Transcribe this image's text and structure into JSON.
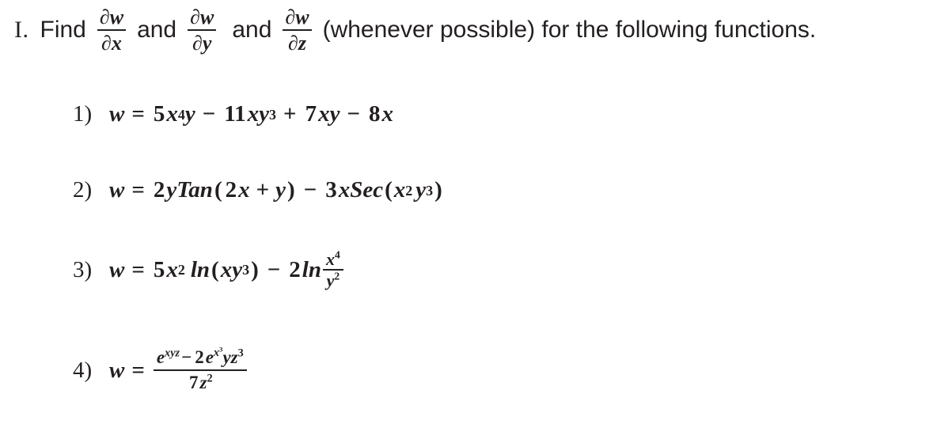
{
  "document": {
    "background_color": "#ffffff",
    "text_color": "#231f20"
  },
  "prompt": {
    "numeral": "I.",
    "verb": "Find",
    "derivative_1": {
      "numerator": "∂w",
      "denominator": "∂x"
    },
    "conjunction_1": "and",
    "derivative_2": {
      "numerator": "∂w",
      "denominator": "∂y"
    },
    "conjunction_2": "and",
    "derivative_3": {
      "numerator": "∂w",
      "denominator": "∂z"
    },
    "tail": "(whenever possible) for the following functions."
  },
  "problems": [
    {
      "number": "1)",
      "lhs": "w",
      "relation": "=",
      "plain": "w = 5x⁴y − 11xy³ + 7xy − 8x",
      "terms": {
        "t1_coef": "5",
        "t1_var": "x",
        "t1_exp": "4",
        "t1_var2": "y",
        "op1": "−",
        "t2_coef": "11",
        "t2_var": "xy",
        "t2_exp": "3",
        "op2": "+",
        "t3_coef": "7",
        "t3_var": "xy",
        "op3": "−",
        "t4_coef": "8",
        "t4_var": "x"
      }
    },
    {
      "number": "2)",
      "lhs": "w",
      "relation": "=",
      "plain": "w = 2yTan(2x + y) − 3xSec(x²y³)",
      "terms": {
        "t1_coef": "2",
        "t1_var": "y",
        "t1_fn": "Tan",
        "t1_arg_open": "(",
        "t1_arg_a": "2",
        "t1_arg_avar": "x",
        "t1_arg_op": "+",
        "t1_arg_b": "y",
        "t1_arg_close": ")",
        "op1": "−",
        "t2_coef": "3",
        "t2_var": "x",
        "t2_fn": "Sec",
        "t2_arg_open": "(",
        "t2_arg_a": "x",
        "t2_arg_aexp": "2",
        "t2_arg_b": "y",
        "t2_arg_bexp": "3",
        "t2_arg_close": ")"
      }
    },
    {
      "number": "3)",
      "lhs": "w",
      "relation": "=",
      "plain": "w = 5x² ln(xy³) − 2ln(x⁴/y²)",
      "terms": {
        "t1_coef": "5",
        "t1_var": "x",
        "t1_exp": "2",
        "t1_fn": "ln",
        "t1_arg_open": "(",
        "t1_arg_a": "xy",
        "t1_arg_aexp": "3",
        "t1_arg_close": ")",
        "op1": "−",
        "t2_coef": "2",
        "t2_fn": "ln",
        "t2_frac_num": "x",
        "t2_frac_num_exp": "4",
        "t2_frac_den": "y",
        "t2_frac_den_exp": "2"
      }
    },
    {
      "number": "4)",
      "lhs": "w",
      "relation": "=",
      "plain": "w = (e^(xyz) − 2e^(x³)yz³) / 7z²",
      "terms": {
        "num_e1": "e",
        "num_e1_exp": "xyz",
        "num_op": "−",
        "num_coef": "2",
        "num_e2": "e",
        "num_e2_exp_base": "x",
        "num_e2_exp_sup": "3",
        "num_tail": "yz",
        "num_tail_exp": "3",
        "den_coef": "7",
        "den_var": "z",
        "den_exp": "2"
      }
    }
  ]
}
